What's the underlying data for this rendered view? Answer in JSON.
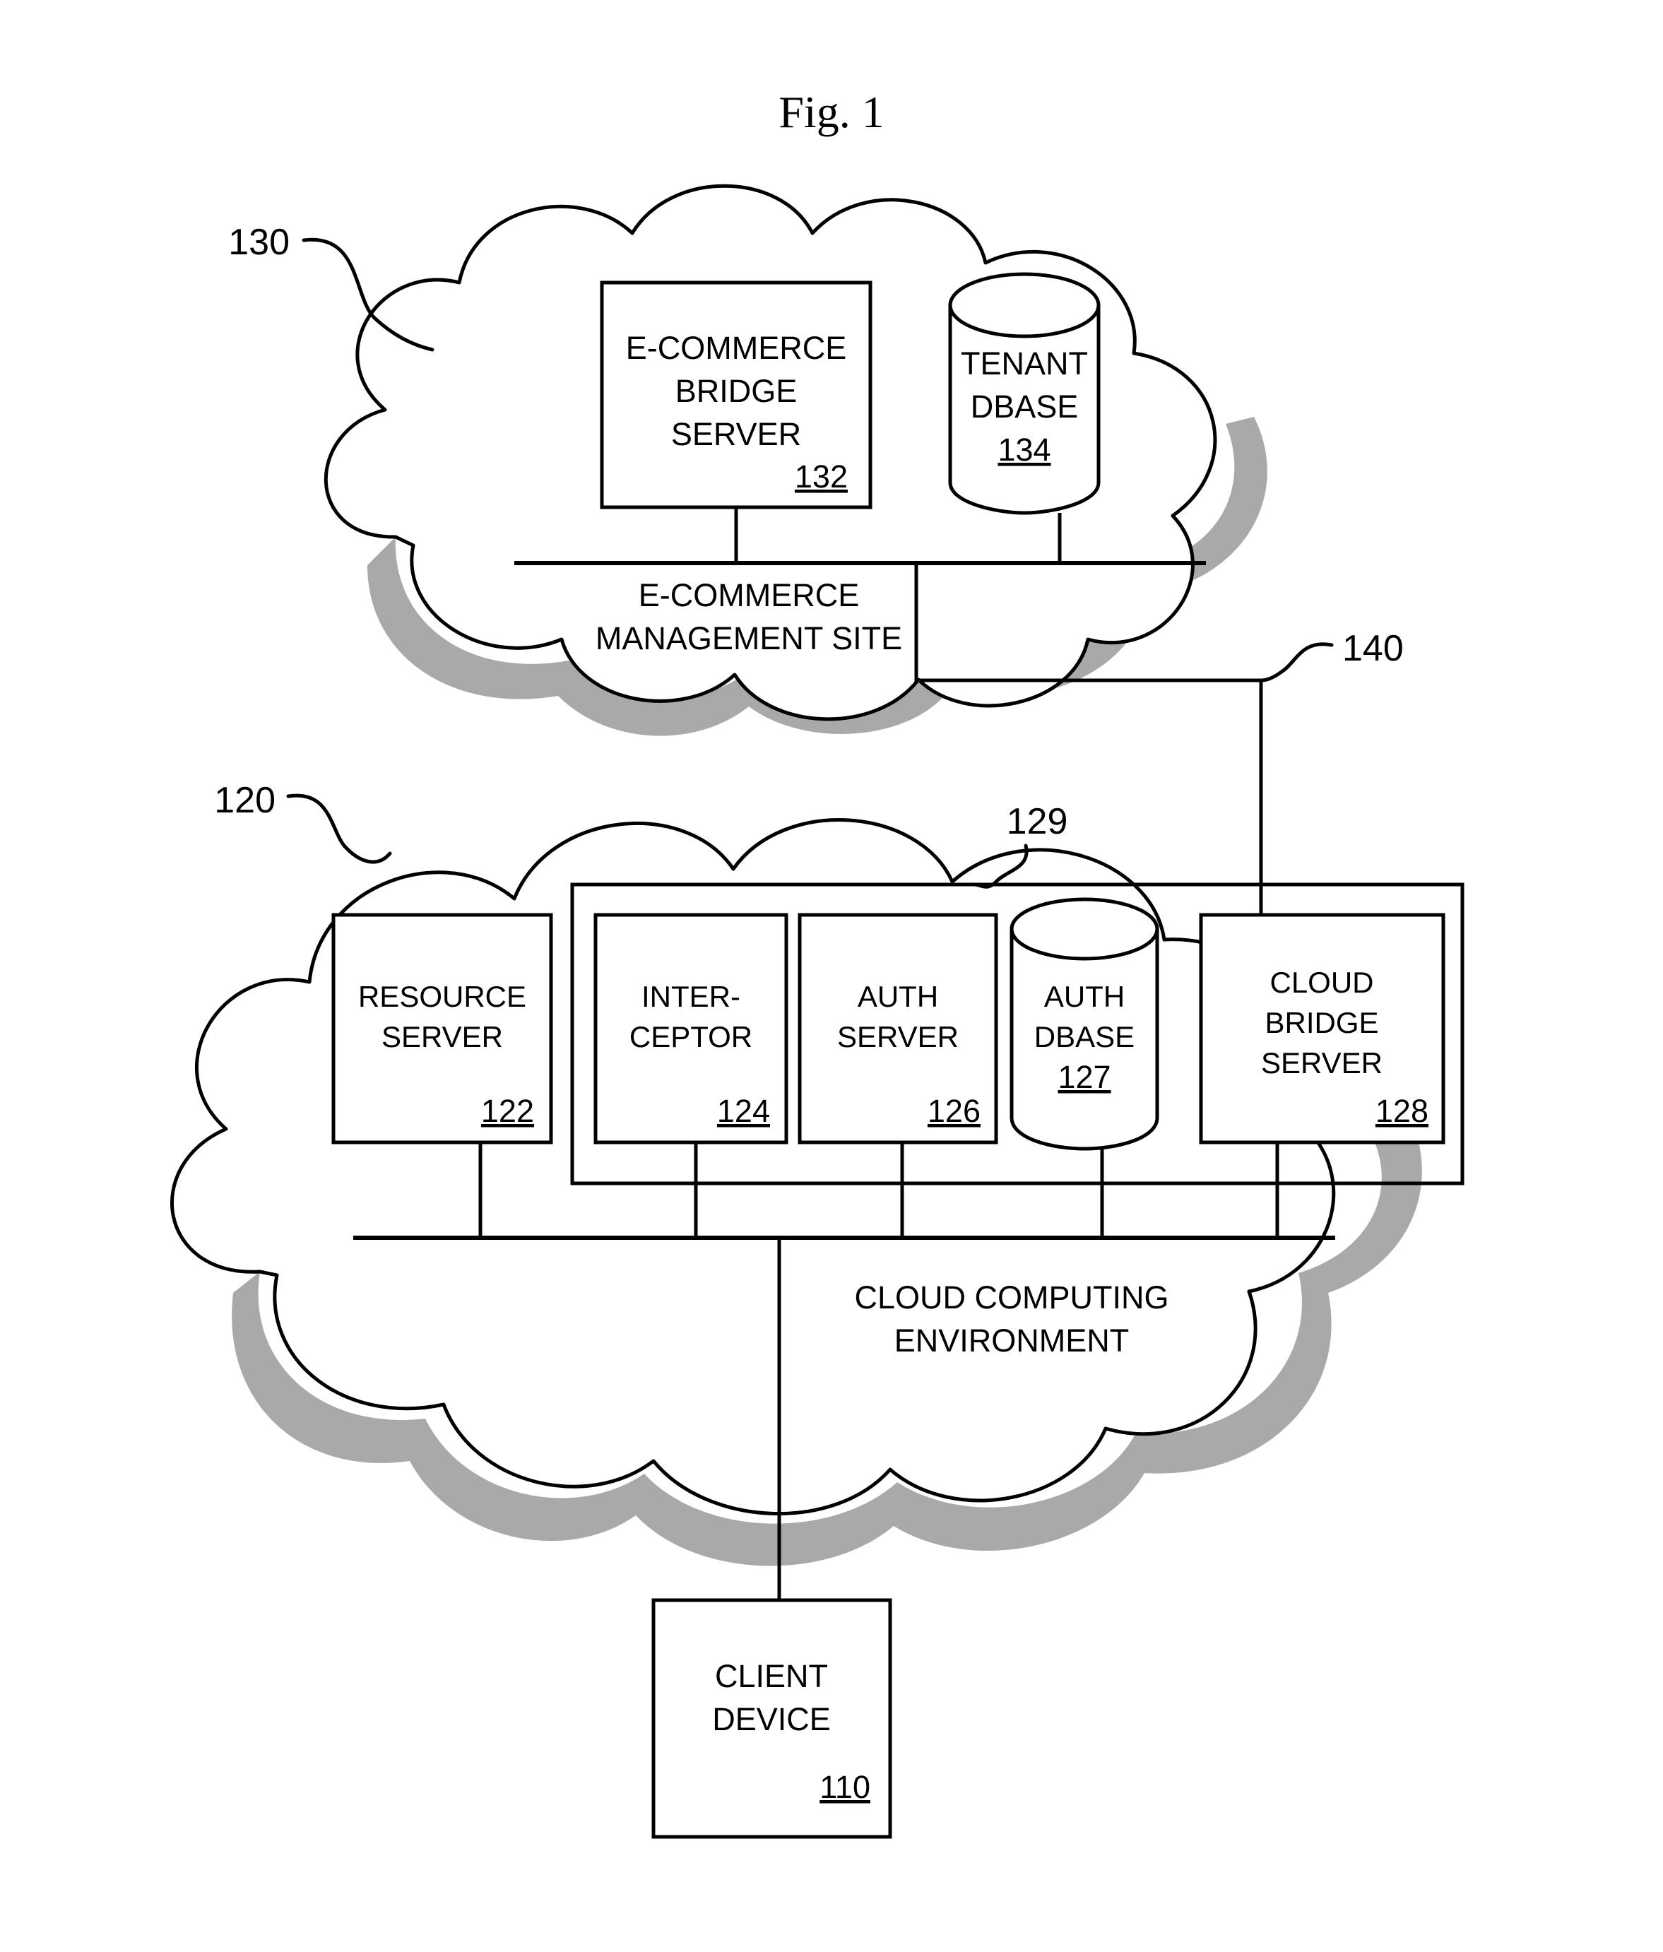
{
  "figure": {
    "title": "Fig.  1"
  },
  "ecommerce_cloud": {
    "callout": "130",
    "region_label_line1": "E-COMMERCE",
    "region_label_line2": "MANAGEMENT SITE",
    "nodes": [
      {
        "name": "ecommerce-bridge-server",
        "shape": "box",
        "line1": "E-COMMERCE",
        "line2": "BRIDGE",
        "line3": "SERVER",
        "ref": "132"
      },
      {
        "name": "tenant-dbase",
        "shape": "cylinder",
        "line1": "TENANT",
        "line2": "DBASE",
        "ref": "134"
      }
    ]
  },
  "link_140": {
    "callout": "140"
  },
  "cloud_computing_cloud": {
    "callout": "120",
    "region_label_line1": "CLOUD COMPUTING",
    "region_label_line2": "ENVIRONMENT",
    "group": {
      "callout": "129"
    },
    "nodes": [
      {
        "name": "resource-server",
        "shape": "box",
        "line1": "RESOURCE",
        "line2": "SERVER",
        "ref": "122"
      },
      {
        "name": "interceptor",
        "shape": "box",
        "line1": "INTER-",
        "line2": "CEPTOR",
        "ref": "124"
      },
      {
        "name": "auth-server",
        "shape": "box",
        "line1": "AUTH",
        "line2": "SERVER",
        "ref": "126"
      },
      {
        "name": "auth-dbase",
        "shape": "cylinder",
        "line1": "AUTH",
        "line2": "DBASE",
        "ref": "127"
      },
      {
        "name": "cloud-bridge-server",
        "shape": "box",
        "line1": "CLOUD",
        "line2": "BRIDGE",
        "line3": "SERVER",
        "ref": "128"
      }
    ]
  },
  "client": {
    "name": "client-device",
    "line1": "CLIENT",
    "line2": "DEVICE",
    "ref": "110"
  },
  "colors": {
    "ink": "#000000",
    "paper": "#ffffff",
    "shadow": "#9a9a9a"
  }
}
